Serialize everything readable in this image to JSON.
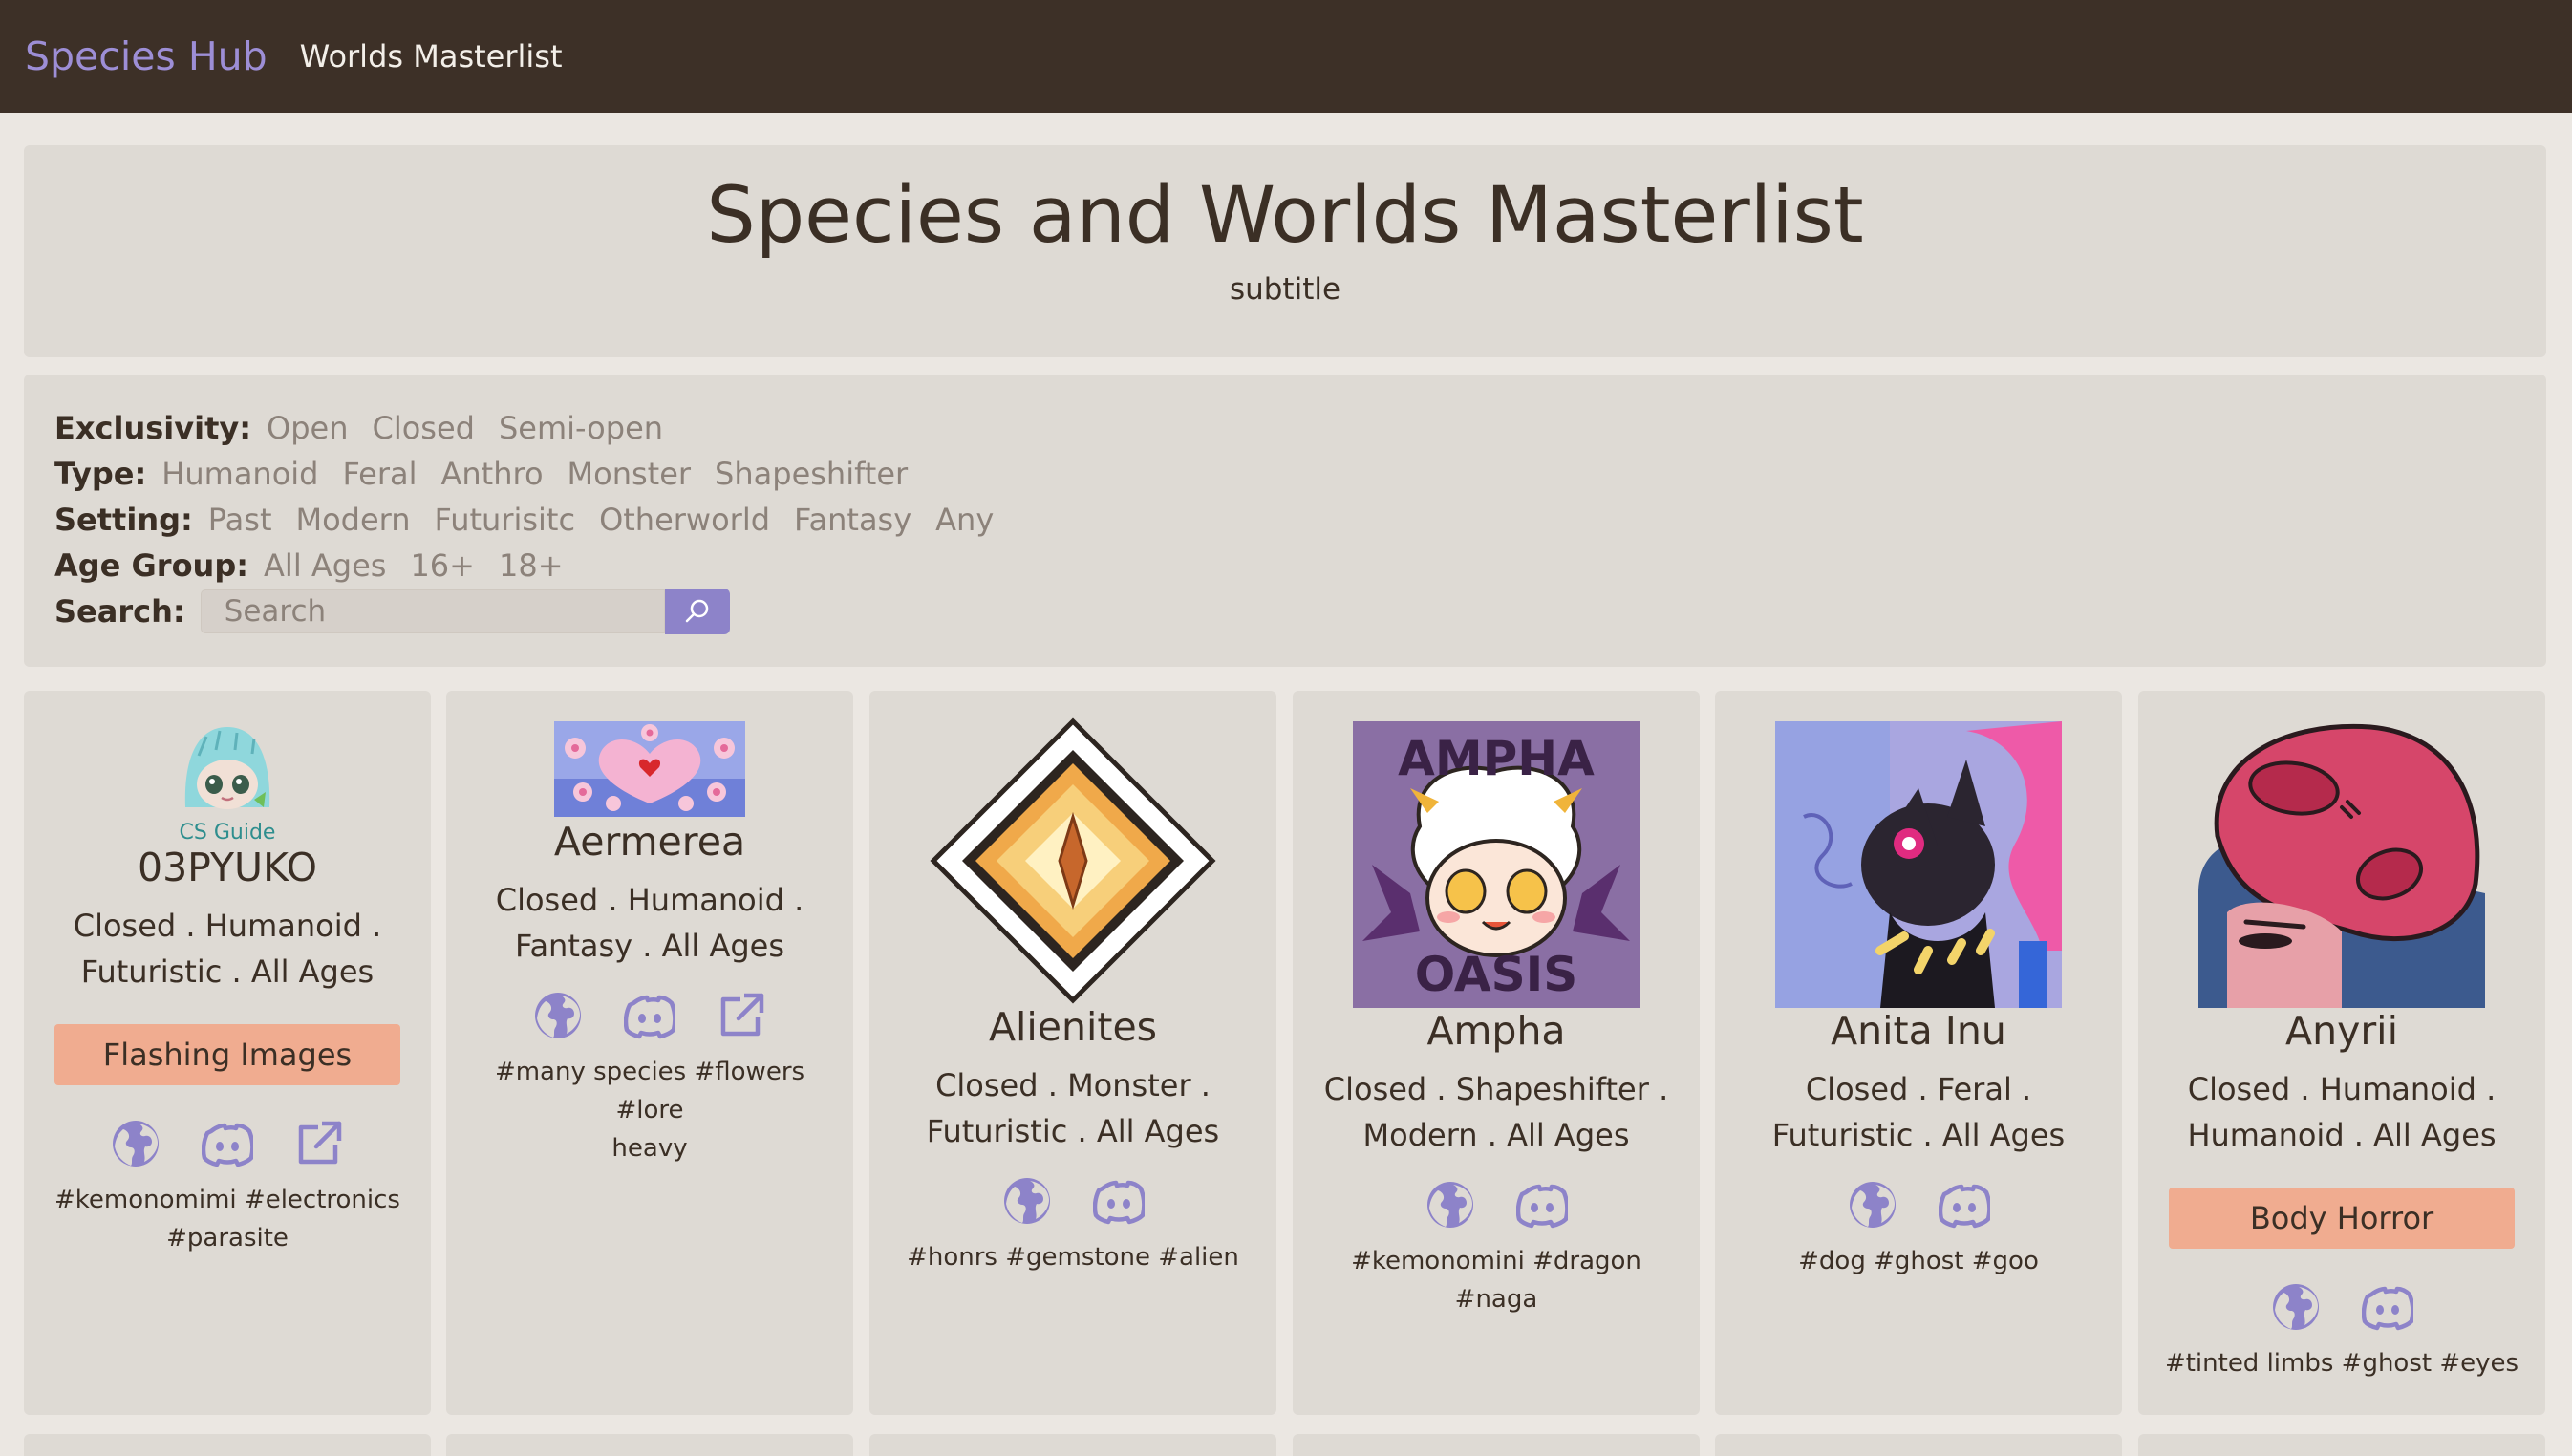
{
  "nav": {
    "brand": "Species Hub",
    "link": "Worlds Masterlist"
  },
  "header": {
    "title": "Species and Worlds Masterlist",
    "subtitle": "subtitle"
  },
  "filters": {
    "exclusivity": {
      "label": "Exclusivity:",
      "options": [
        "Open",
        "Closed",
        "Semi-open"
      ]
    },
    "type": {
      "label": "Type:",
      "options": [
        "Humanoid",
        "Feral",
        "Anthro",
        "Monster",
        "Shapeshifter"
      ]
    },
    "setting": {
      "label": "Setting:",
      "options": [
        "Past",
        "Modern",
        "Futurisitc",
        "Otherworld",
        "Fantasy",
        "Any"
      ]
    },
    "age_group": {
      "label": "Age Group:",
      "options": [
        "All Ages",
        "16+",
        "18+"
      ]
    },
    "search": {
      "label": "Search:",
      "placeholder": "Search"
    }
  },
  "colors": {
    "navbar": "#3d3027",
    "brand": "#9d8ed6",
    "accent": "#8d83c9",
    "warning": "#f0ac90",
    "panel": "#dedad4",
    "background": "#ebe7e2"
  },
  "cards": [
    {
      "name": "03PYUKO",
      "img_caption": "CS Guide",
      "meta1": "Closed . Humanoid .",
      "meta2": "Futuristic . All Ages",
      "warning": "Flashing Images",
      "icons": [
        "globe-icon",
        "discord-icon",
        "external-link-icon"
      ],
      "tags1": "#kemonomimi #electronics",
      "tags2": "#parasite"
    },
    {
      "name": "Aermerea",
      "meta1": "Closed . Humanoid .",
      "meta2": "Fantasy . All Ages",
      "icons": [
        "globe-icon",
        "discord-icon",
        "external-link-icon"
      ],
      "tags1": "#many species #flowers #lore",
      "tags2": "heavy"
    },
    {
      "name": "Alienites",
      "meta1": "Closed . Monster .",
      "meta2": "Futuristic . All Ages",
      "icons": [
        "globe-icon",
        "discord-icon"
      ],
      "tags1": "#honrs #gemstone #alien"
    },
    {
      "name": "Ampha",
      "img_text1": "AMPHA",
      "img_text2": "OASIS",
      "meta1": "Closed . Shapeshifter .",
      "meta2": "Modern . All Ages",
      "icons": [
        "globe-icon",
        "discord-icon"
      ],
      "tags1": "#kemonomini #dragon #naga"
    },
    {
      "name": "Anita Inu",
      "meta1": "Closed . Feral .",
      "meta2": "Futuristic . All Ages",
      "icons": [
        "globe-icon",
        "discord-icon"
      ],
      "tags1": "#dog #ghost #goo"
    },
    {
      "name": "Anyrii",
      "meta1": "Closed . Humanoid .",
      "meta2": "Humanoid . All Ages",
      "warning": "Body Horror",
      "icons": [
        "globe-icon",
        "discord-icon"
      ],
      "tags1": "#tinted limbs #ghost #eyes"
    }
  ]
}
